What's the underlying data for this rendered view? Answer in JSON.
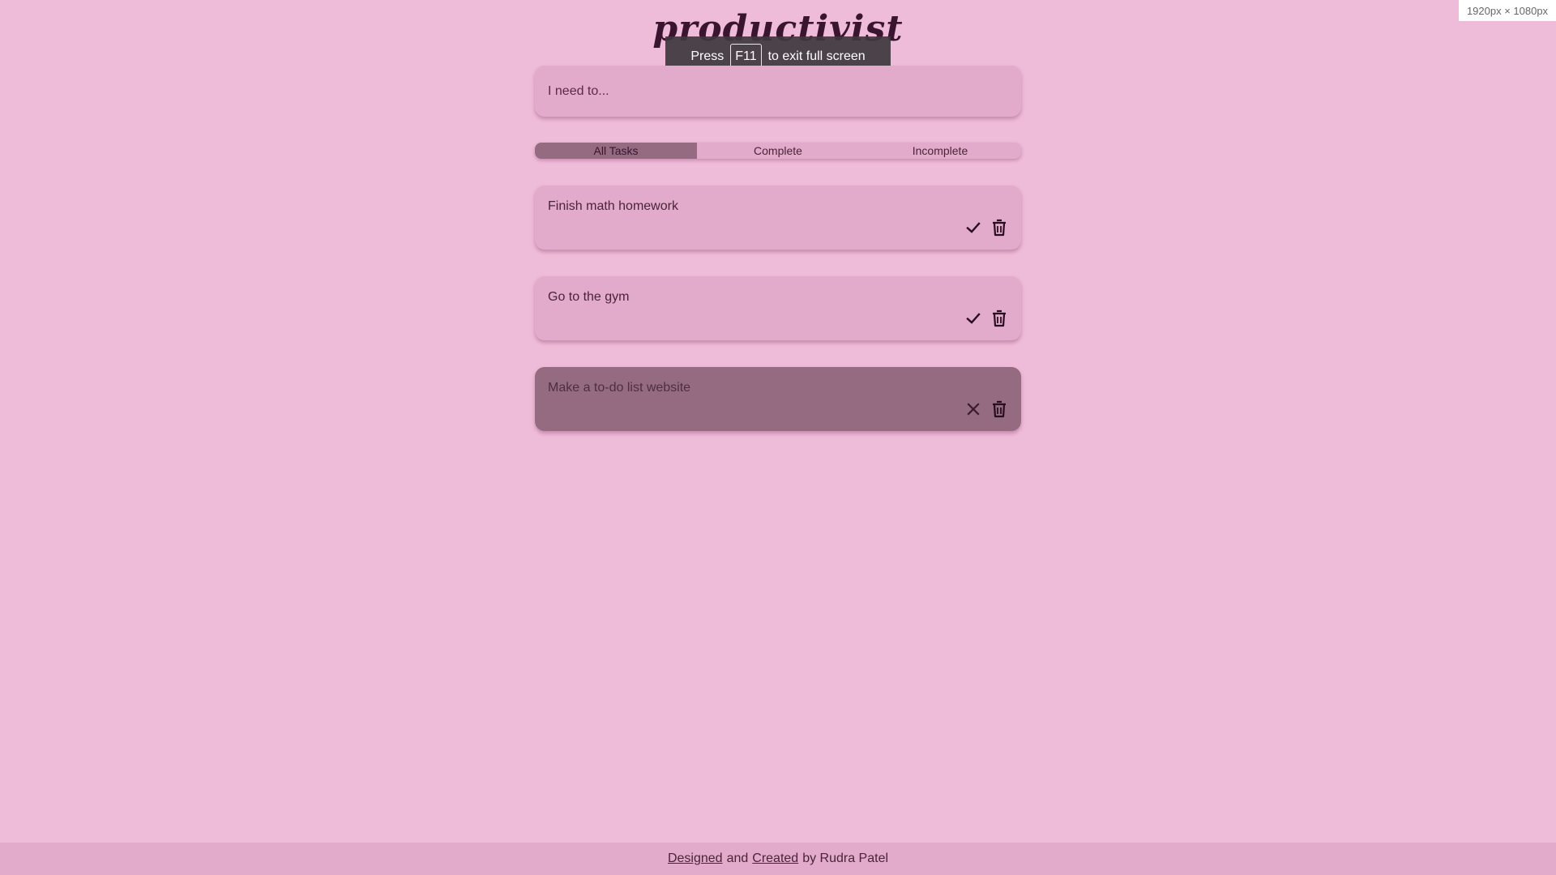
{
  "app": {
    "title": "productivist"
  },
  "fullscreen_toast": {
    "press": "Press",
    "key": "F11",
    "message": "to exit full screen"
  },
  "dimension_badge": "1920px × 1080px",
  "input": {
    "placeholder": "I need to..."
  },
  "filters": [
    {
      "label": "All Tasks",
      "active": true
    },
    {
      "label": "Complete",
      "active": false
    },
    {
      "label": "Incomplete",
      "active": false
    }
  ],
  "tasks": [
    {
      "text": "Finish math homework",
      "completed": false,
      "action_icon": "check-icon"
    },
    {
      "text": "Go to the gym",
      "completed": false,
      "action_icon": "check-icon"
    },
    {
      "text": "Make a to-do list website",
      "completed": true,
      "action_icon": "close-icon"
    }
  ],
  "footer": {
    "designed": "Designed",
    "and": "and",
    "created": "Created",
    "by": "by Rudra Patel"
  },
  "colors": {
    "background": "#eebbd8",
    "card": "#e2aacb",
    "card_done": "#946b81",
    "text": "#4a2438"
  }
}
